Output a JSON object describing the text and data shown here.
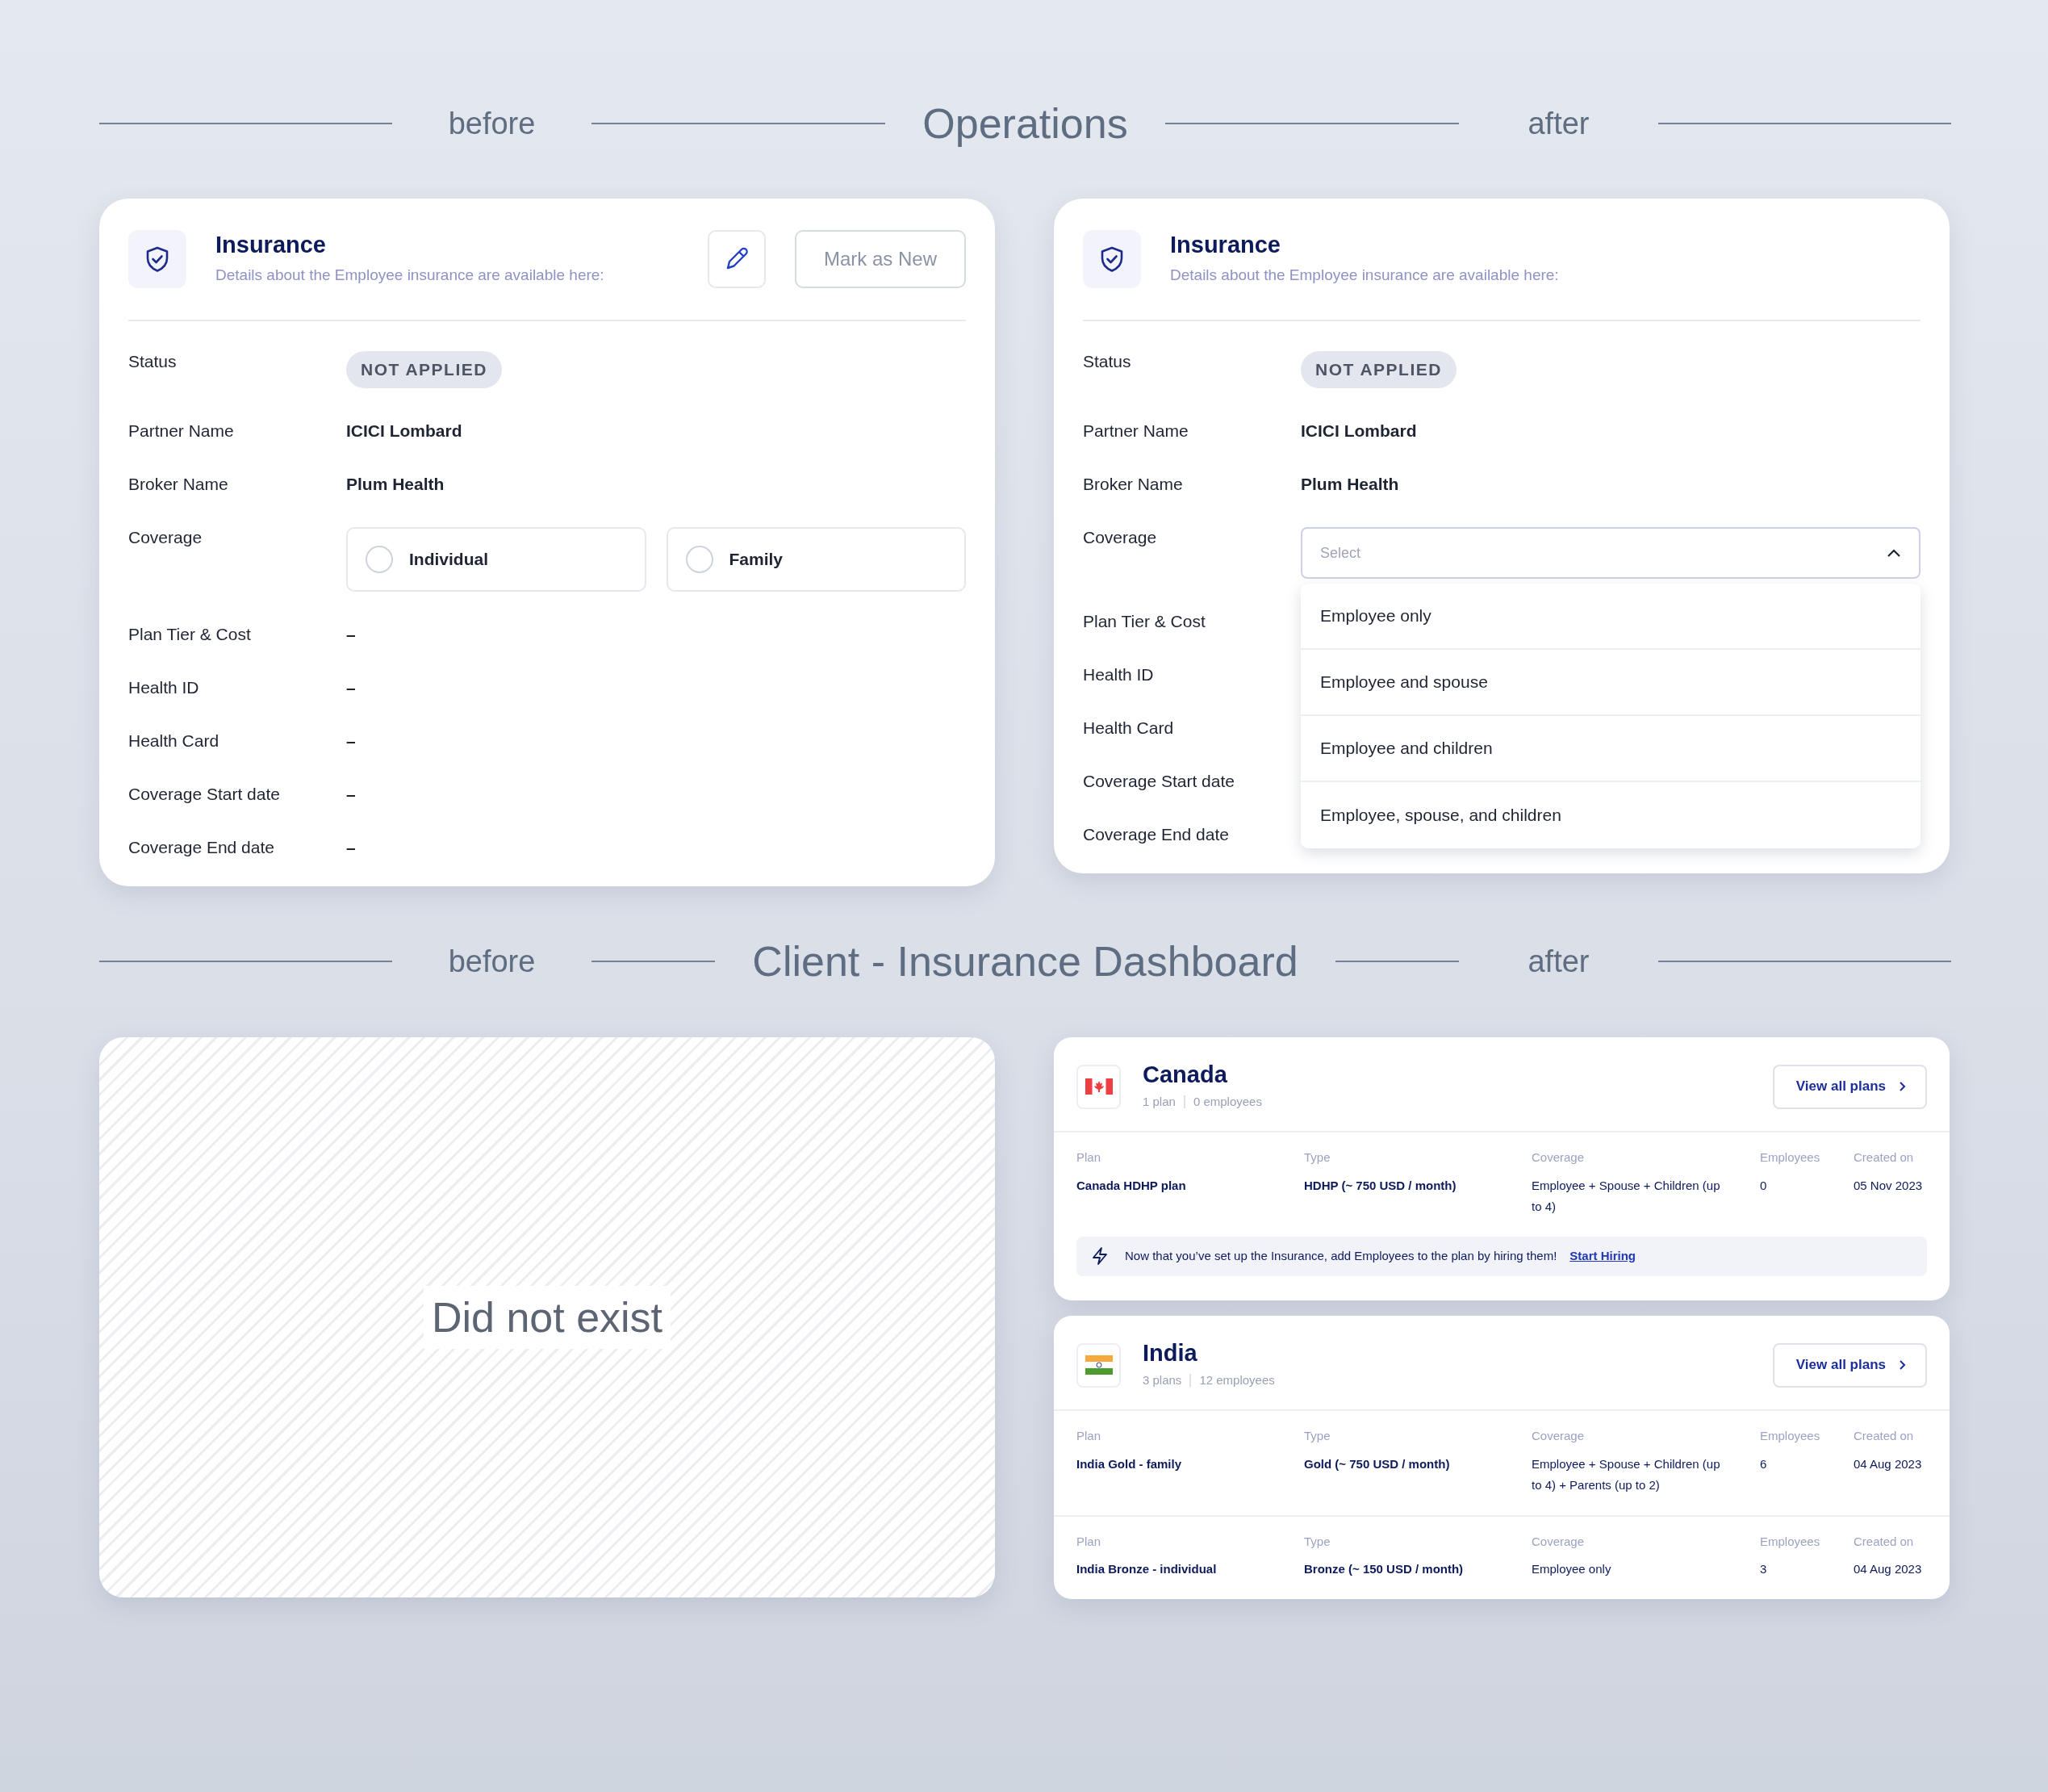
{
  "operations": {
    "title": "Operations",
    "before_label": "before",
    "after_label": "after",
    "before_card": {
      "title": "Insurance",
      "subtitle": "Details about the Employee insurance are available here:",
      "mark_button": "Mark as New",
      "fields": [
        {
          "label": "Status",
          "kind": "badge",
          "value": "NOT APPLIED"
        },
        {
          "label": "Partner Name",
          "kind": "text",
          "value": "ICICI Lombard"
        },
        {
          "label": "Broker Name",
          "kind": "text",
          "value": "Plum Health"
        },
        {
          "label": "Coverage",
          "kind": "radio",
          "options": [
            {
              "label": "Individual",
              "selected": false
            },
            {
              "label": "Family",
              "selected": false
            }
          ]
        },
        {
          "label": "Plan Tier & Cost",
          "kind": "text",
          "value": "–"
        },
        {
          "label": "Health ID",
          "kind": "text",
          "value": "–"
        },
        {
          "label": "Health Card",
          "kind": "text",
          "value": "–"
        },
        {
          "label": "Coverage Start date",
          "kind": "text",
          "value": "–"
        },
        {
          "label": "Coverage End date",
          "kind": "text",
          "value": "–"
        }
      ]
    },
    "after_card": {
      "title": "Insurance",
      "subtitle": "Details about the Employee insurance are available here:",
      "fields": [
        {
          "label": "Status",
          "kind": "badge",
          "value": "NOT APPLIED"
        },
        {
          "label": "Partner Name",
          "kind": "text",
          "value": "ICICI Lombard"
        },
        {
          "label": "Broker Name",
          "kind": "text",
          "value": "Plum Health"
        },
        {
          "label": "Coverage",
          "kind": "dropdown",
          "placeholder": "Select",
          "expanded": true,
          "options": [
            "Employee only",
            "Employee and spouse",
            "Employee and children",
            "Employee, spouse, and children"
          ]
        },
        {
          "label": "Plan Tier & Cost",
          "kind": "text"
        },
        {
          "label": "Health ID",
          "kind": "text"
        },
        {
          "label": "Health Card",
          "kind": "text"
        },
        {
          "label": "Coverage Start date",
          "kind": "text"
        },
        {
          "label": "Coverage End date",
          "kind": "text"
        }
      ]
    }
  },
  "dashboard": {
    "title": "Client - Insurance Dashboard",
    "before_label": "before",
    "after_label": "after",
    "before_panel": {
      "text": "Did not exist"
    },
    "countries": [
      {
        "name": "Canada",
        "kind": "canada",
        "plans_count": "1 plan",
        "employees_count": "0 employees",
        "button": "View all plans",
        "plans": [
          {
            "headers": [
              "Plan",
              "Type",
              "Coverage",
              "Employees",
              "Created on"
            ],
            "plan": "Canada HDHP plan",
            "type": "HDHP (~ 750 USD / month)",
            "coverage": "Employee + Spouse + Children (up to 4)",
            "employees": "0",
            "created": "05 Nov 2023"
          }
        ],
        "notice": {
          "text": "Now that you’ve set up the Insurance, add Employees to the plan by hiring them!",
          "link": "Start Hiring"
        }
      },
      {
        "name": "India",
        "kind": "india",
        "plans_count": "3 plans",
        "employees_count": "12 employees",
        "button": "View all plans",
        "plans": [
          {
            "headers": [
              "Plan",
              "Type",
              "Coverage",
              "Employees",
              "Created on"
            ],
            "plan": "India Gold - family",
            "type": "Gold (~ 750 USD / month)",
            "coverage": "Employee + Spouse + Children (up to 4) + Parents (up to 2)",
            "employees": "6",
            "created": "04 Aug 2023"
          },
          {
            "headers": [
              "Plan",
              "Type",
              "Coverage",
              "Employees",
              "Created on"
            ],
            "plan": "India Bronze - individual",
            "type": "Bronze (~ 150 USD / month)",
            "coverage": "Employee only",
            "employees": "3",
            "created": "04 Aug 2023"
          }
        ]
      }
    ]
  }
}
